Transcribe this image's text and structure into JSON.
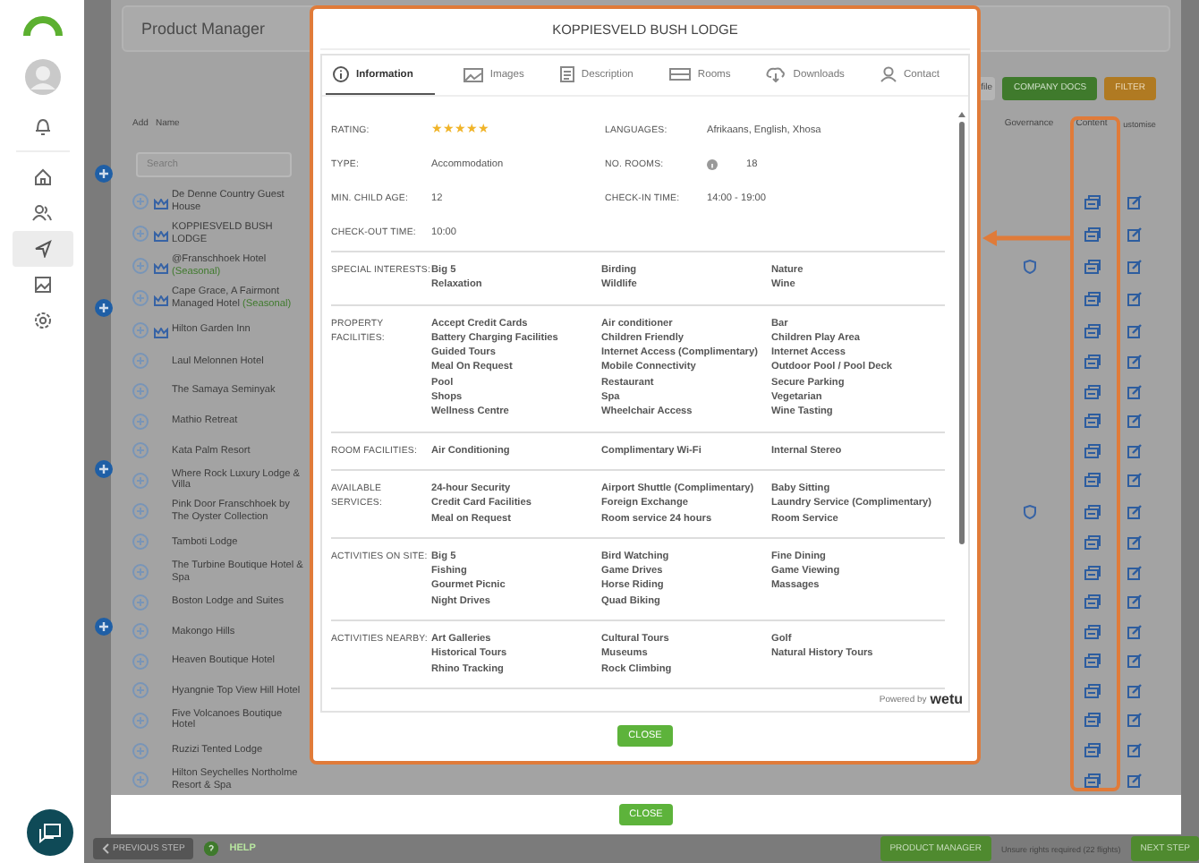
{
  "sidebar": {
    "items": [
      {
        "kind": "avatar",
        "selected": false
      },
      {
        "kind": "bell",
        "selected": false
      },
      {
        "kind": "home",
        "selected": false
      },
      {
        "kind": "users",
        "selected": false
      },
      {
        "kind": "send",
        "selected": true
      },
      {
        "kind": "image",
        "selected": false
      },
      {
        "kind": "settings",
        "selected": false
      }
    ]
  },
  "product_manager": {
    "title": "Product Manager",
    "toolbar": [
      {
        "label": "file",
        "kind": "plain"
      },
      {
        "label": "COMPANY DOCS",
        "kind": "primary"
      },
      {
        "label": "FILTER",
        "kind": "warning"
      }
    ],
    "columns": {
      "add": "Add",
      "name": "Name",
      "governance": "Governance",
      "content": "Content",
      "customise": "ustomise"
    },
    "search": {
      "placeholder": "Search"
    },
    "rows": [
      {
        "name": "De Denne Country Guest House",
        "crown": true,
        "governance": false
      },
      {
        "name": "KOPPIESVELD BUSH LODGE",
        "crown": true,
        "governance": false
      },
      {
        "name": "@Franschhoek Hotel",
        "tag": "(Seasonal)",
        "crown": true,
        "governance": true
      },
      {
        "name": "Cape Grace, A Fairmont Managed Hotel",
        "tag": "(Seasonal)",
        "crown": true,
        "governance": false
      },
      {
        "name": "Hilton Garden Inn",
        "crown": true,
        "governance": false
      },
      {
        "name": "Laul Melonnen Hotel",
        "crown": false,
        "governance": false
      },
      {
        "name": "The Samaya Seminyak",
        "crown": false,
        "governance": false
      },
      {
        "name": "Mathio Retreat",
        "crown": false,
        "governance": false
      },
      {
        "name": "Kata Palm Resort",
        "crown": false,
        "governance": false
      },
      {
        "name": "Where Rock Luxury Lodge & Villa",
        "crown": false,
        "governance": false
      },
      {
        "name": "Pink Door Franschhoek by The Oyster Collection",
        "crown": false,
        "governance": true
      },
      {
        "name": "Tamboti Lodge",
        "crown": false,
        "governance": false
      },
      {
        "name": "The Turbine Boutique Hotel & Spa",
        "crown": false,
        "governance": false
      },
      {
        "name": "Boston Lodge and Suites",
        "crown": false,
        "governance": false
      },
      {
        "name": "Makongo Hills",
        "crown": false,
        "governance": false
      },
      {
        "name": "Heaven Boutique Hotel",
        "crown": false,
        "governance": false
      },
      {
        "name": "Hyangnie Top View Hill Hotel",
        "crown": false,
        "governance": false
      },
      {
        "name": "Five Volcanoes Boutique Hotel",
        "crown": false,
        "governance": false
      },
      {
        "name": "Ruzizi Tented Lodge",
        "crown": false,
        "governance": false
      },
      {
        "name": "Hilton Seychelles Northolme Resort & Spa",
        "crown": false,
        "governance": false
      }
    ],
    "close": "CLOSE"
  },
  "modal": {
    "title": "KOPPIESVELD BUSH LODGE",
    "tabs": [
      {
        "label": "Information",
        "kind": "info",
        "selected": true
      },
      {
        "label": "Images",
        "kind": "image",
        "selected": false
      },
      {
        "label": "Description",
        "kind": "document",
        "selected": false
      },
      {
        "label": "Rooms",
        "kind": "bed",
        "selected": false
      },
      {
        "label": "Downloads",
        "kind": "download",
        "selected": false
      },
      {
        "label": "Contact",
        "kind": "person",
        "selected": false
      }
    ],
    "fields": [
      {
        "label": "RATING:",
        "kind": "stars",
        "stars": 5
      },
      {
        "label": "LANGUAGES:",
        "kind": "text",
        "value": "Afrikaans, English, Xhosa"
      },
      {
        "label": "TYPE:",
        "kind": "text",
        "value": "Accommodation"
      },
      {
        "label": "NO. ROOMS:",
        "kind": "info",
        "value": "18"
      },
      {
        "label": "MIN. CHILD AGE:",
        "kind": "text",
        "value": "12"
      },
      {
        "label": "CHECK-IN TIME:",
        "kind": "text",
        "value": "14:00 - 19:00"
      },
      {
        "label": "CHECK-OUT TIME:",
        "kind": "text",
        "value": "10:00"
      }
    ],
    "sections": [
      {
        "label": "SPECIAL INTERESTS:",
        "items": [
          "Big 5",
          "Birding",
          "Nature",
          "Relaxation",
          "Wildlife",
          "Wine"
        ]
      },
      {
        "label": "PROPERTY FACILITIES:",
        "items": [
          "Accept Credit Cards",
          "Air conditioner",
          "Bar",
          "Battery Charging Facilities",
          "Children Friendly",
          "Children Play Area",
          "Guided Tours",
          "Internet Access (Complimentary)",
          "Internet Access",
          "Meal On Request",
          "Mobile Connectivity",
          "Outdoor Pool / Pool Deck",
          "Pool",
          "Restaurant",
          "Secure Parking",
          "Shops",
          "Spa",
          "Vegetarian",
          "Wellness Centre",
          "Wheelchair Access",
          "Wine Tasting"
        ]
      },
      {
        "label": "ROOM FACILITIES:",
        "items": [
          "Air Conditioning",
          "Complimentary Wi-Fi",
          "Internal Stereo"
        ]
      },
      {
        "label": "AVAILABLE SERVICES:",
        "items": [
          "24-hour Security",
          "Airport Shuttle (Complimentary)",
          "Baby Sitting",
          "Credit Card Facilities",
          "Foreign Exchange",
          "Laundry Service (Complimentary)",
          "Meal on Request",
          "Room service 24 hours",
          "Room Service"
        ]
      },
      {
        "label": "ACTIVITIES ON SITE:",
        "items": [
          "Big 5",
          "Bird Watching",
          "Fine Dining",
          "Fishing",
          "Game Drives",
          "Game Viewing",
          "Gourmet Picnic",
          "Horse Riding",
          "Massages",
          "Night Drives",
          "Quad Biking"
        ]
      },
      {
        "label": "ACTIVITIES NEARBY:",
        "items": [
          "Art Galleries",
          "Cultural Tours",
          "Golf",
          "Historical Tours",
          "Museums",
          "Natural History Tours",
          "Rhino Tracking",
          "Rock Climbing"
        ]
      }
    ],
    "powered_by": "Powered by",
    "brand": "wetu",
    "close": "CLOSE"
  },
  "footer": {
    "previous": "PREVIOUS STEP",
    "help": "HELP",
    "product_manager": "PRODUCT MANAGER",
    "note": "Unsure rights required (22 flights)",
    "next": "NEXT STEP"
  }
}
